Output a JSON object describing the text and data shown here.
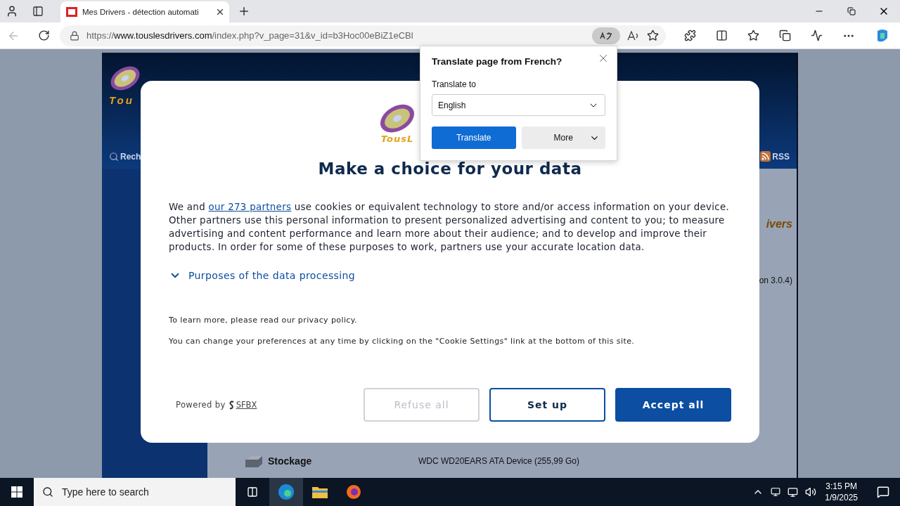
{
  "browser": {
    "tab": {
      "title": "Mes Drivers - détection automati"
    },
    "address": {
      "scheme": "https://",
      "host": "www.touslesdrivers.com",
      "path": "/index.php?v_page=31&v_id=b3Hoc00eBiZ1eCBl"
    }
  },
  "site": {
    "logo_text": "Tou",
    "search_link": "Rech",
    "rss": "RSS",
    "banner_text": "ivers",
    "version_text": "on 3.0.4)",
    "storage": {
      "label": "Stockage",
      "value": "WDC WD20EARS ATA Device (255,99 Go)"
    }
  },
  "consent": {
    "logo_text": "TousL",
    "title": "Make a choice for your data",
    "body_before": "We and ",
    "partners_link": "our 273 partners",
    "body_after": " use cookies or equivalent technology to store and/or access information on your device. Other partners use this personal information to present personalized advertising and content to you; to measure advertising and content performance and learn more about their audience; and to develop and improve their products. In order for some of these purposes to work, partners use your accurate location data.",
    "purposes": {
      "label": "Purposes of the data processing",
      "expanded": false
    },
    "learn_more": "To learn more, please read our privacy policy.",
    "preferences": "You can change your preferences at any time by clicking on the \"Cookie Settings\" link at the bottom of this site.",
    "powered_by": "Powered by",
    "brand": "SFBX",
    "buttons": [
      {
        "label": "Refuse all",
        "kind": "muted"
      },
      {
        "label": "Set up",
        "kind": "outline"
      },
      {
        "label": "Accept all",
        "kind": "primary"
      }
    ]
  },
  "translate_popup": {
    "title": "Translate page from French?",
    "label": "Translate to",
    "language": "English",
    "buttons": [
      {
        "label": "Translate",
        "kind": "primary"
      },
      {
        "label": "More",
        "kind": "menu"
      }
    ]
  },
  "taskbar": {
    "search_placeholder": "Type here to search",
    "time": "3:15 PM",
    "date": "1/9/2025"
  }
}
